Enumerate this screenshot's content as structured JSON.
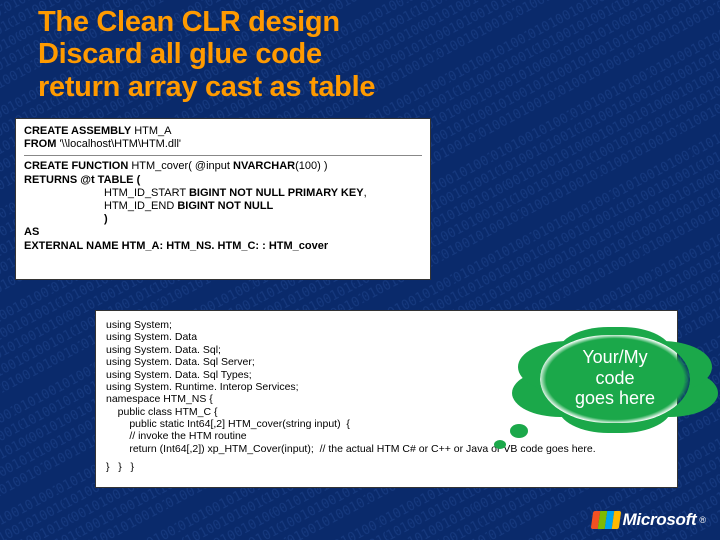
{
  "title": {
    "line1": "The Clean CLR design",
    "line2": "Discard all glue code",
    "line3": "return array cast as table"
  },
  "sql": {
    "l1a": "CREATE ASSEMBLY",
    "l1b": " HTM_A",
    "l2a": "FROM",
    "l2b": " '\\\\localhost\\HTM\\HTM.dll'",
    "l3a": "CREATE FUNCTION",
    "l3b": " HTM_cover( @input ",
    "l3c": "NVARCHAR",
    "l3d": "(100) )",
    "l4": "RETURNS @t TABLE (",
    "l5a": "HTM_ID_START ",
    "l5b": "BIGINT NOT NULL PRIMARY KEY",
    "l5c": ",",
    "l6a": "HTM_ID_END   ",
    "l6b": "BIGINT NOT NULL",
    "l7": ")",
    "l8": "AS",
    "l9": "EXTERNAL NAME HTM_A: HTM_NS. HTM_C: : HTM_cover"
  },
  "code": {
    "l1": "using System;",
    "l2": "using System. Data",
    "l3": "using System. Data. Sql;",
    "l4": "using System. Data. Sql Server;",
    "l5": "using System. Data. Sql Types;",
    "l6": "using System. Runtime. Interop Services;",
    "l7": "namespace HTM_NS {",
    "l8": "    public class HTM_C {",
    "l9": "        public static Int64[,2] HTM_cover(string input)  {",
    "l10": "        // invoke the HTM routine",
    "l11": "        return (Int64[,2]) xp_HTM_Cover(input);  // the actual HTM C# or C++ or Java or VB code goes here.",
    "l12": "}   }   }"
  },
  "bubble": {
    "line1": "Your/My",
    "line2": "code",
    "line3": "goes here"
  },
  "logo": {
    "text": "Microsoft"
  }
}
